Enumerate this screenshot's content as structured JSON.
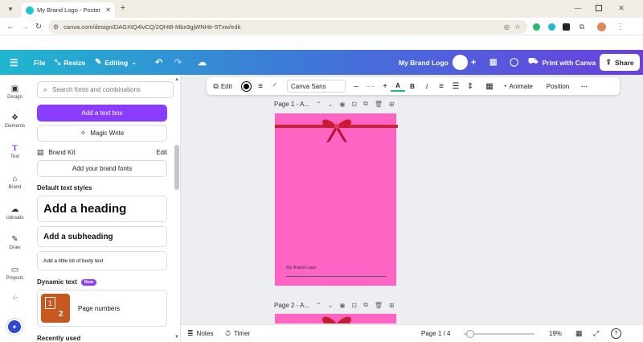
{
  "browser": {
    "tab_title": "My Brand Logo - Poster - Canva",
    "url": "canva.com/design/DAGXtQ4lvCQ/2QHt8-Mbx9gjWNHtr-5Txw/edit"
  },
  "canva_toolbar": {
    "file": "File",
    "resize": "Resize",
    "editing": "Editing",
    "design_title": "My Brand Logo",
    "print": "Print with Canva",
    "share": "Share"
  },
  "rail": {
    "items": [
      {
        "label": "Design",
        "icon": "design-icon"
      },
      {
        "label": "Elements",
        "icon": "elements-icon"
      },
      {
        "label": "Text",
        "icon": "text-icon"
      },
      {
        "label": "Brand",
        "icon": "brand-icon"
      },
      {
        "label": "Uploads",
        "icon": "uploads-icon"
      },
      {
        "label": "Draw",
        "icon": "draw-icon"
      },
      {
        "label": "Projects",
        "icon": "projects-icon"
      }
    ]
  },
  "panel": {
    "search_placeholder": "Search fonts and combinations",
    "add_text_box": "Add a text box",
    "magic_write": "Magic Write",
    "brand_kit": "Brand Kit",
    "brand_edit": "Edit",
    "add_brand_fonts": "Add your brand fonts",
    "default_styles": "Default text styles",
    "heading": "Add a heading",
    "subheading": "Add a subheading",
    "body": "Add a little bit of body text",
    "dynamic_text": "Dynamic text",
    "new_badge": "New",
    "page_numbers": "Page numbers",
    "page_numbers_thumb_a": "1",
    "page_numbers_thumb_b": "2",
    "recently_used": "Recently used"
  },
  "editbar": {
    "edit": "Edit",
    "font": "Canva Sans",
    "size": "– –",
    "animate": "Animate",
    "position": "Position"
  },
  "canvas": {
    "page1_label": "Page 1 - A...",
    "page2_label": "Page 2 - A...",
    "page_text": "My Brand Logo",
    "page_color": "#fe64c4"
  },
  "bottom": {
    "notes": "Notes",
    "timer": "Timer",
    "page_indicator": "Page 1 / 4",
    "zoom": "19%"
  }
}
